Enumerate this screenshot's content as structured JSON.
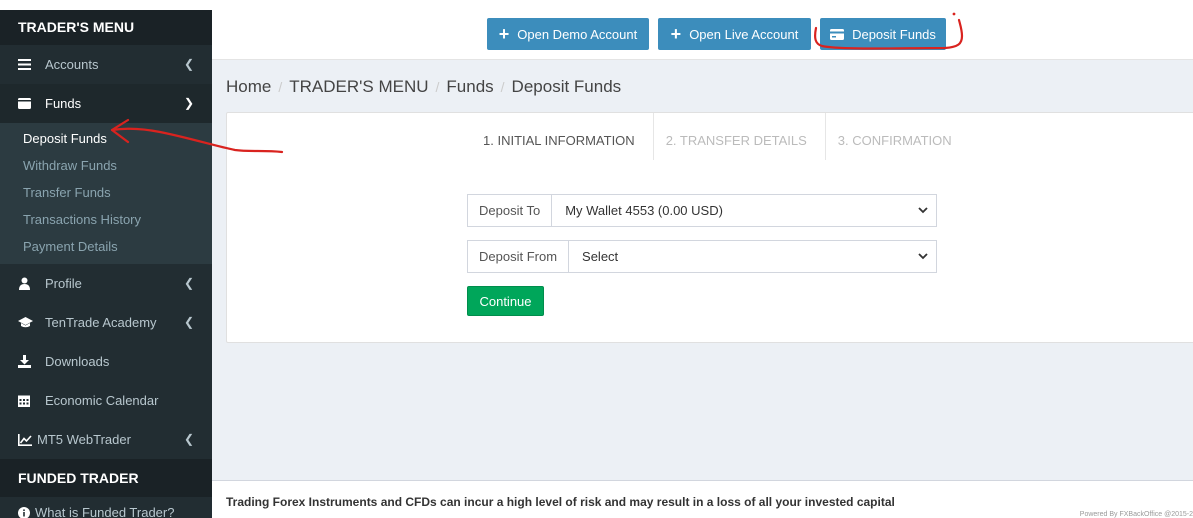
{
  "sidebar": {
    "header": "TRADER'S MENU",
    "accounts": "Accounts",
    "funds": "Funds",
    "funds_sub": [
      "Deposit Funds",
      "Withdraw Funds",
      "Transfer Funds",
      "Transactions History",
      "Payment Details"
    ],
    "profile": "Profile",
    "academy": "TenTrade Academy",
    "downloads": "Downloads",
    "calendar": "Economic Calendar",
    "webtrader": "MT5 WebTrader",
    "funded_header": "FUNDED TRADER",
    "what_is": "What is Funded Trader?"
  },
  "navbar": {
    "demo": "Open Demo Account",
    "live": "Open Live Account",
    "deposit": "Deposit Funds"
  },
  "breadcrumb": [
    "Home",
    "TRADER'S MENU",
    "Funds",
    "Deposit Funds"
  ],
  "steps": [
    "1. INITIAL INFORMATION",
    "2. TRANSFER DETAILS",
    "3. CONFIRMATION"
  ],
  "form": {
    "deposit_to_label": "Deposit To",
    "deposit_to_value": "My Wallet 4553 (0.00 USD)",
    "deposit_from_label": "Deposit From",
    "deposit_from_value": "Select",
    "continue": "Continue"
  },
  "footer": {
    "warning": "Trading Forex Instruments and CFDs can incur a high level of risk and may result in a loss of all your invested capital",
    "powered": "Powered By FXBackOffice @2015-2"
  },
  "colors": {
    "sidebar_bg": "#222d32",
    "primary": "#3c8dbc",
    "success": "#00a65a",
    "annotation": "#d9231f"
  }
}
